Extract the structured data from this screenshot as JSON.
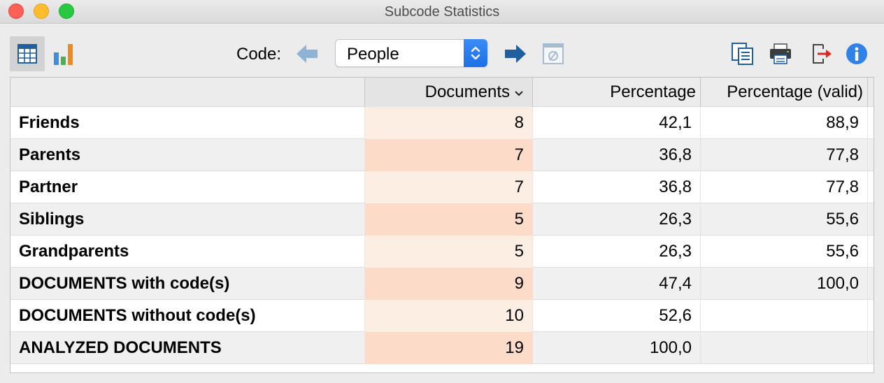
{
  "window": {
    "title": "Subcode Statistics"
  },
  "toolbar": {
    "code_label": "Code:",
    "code_select": {
      "value": "People"
    },
    "icons": {
      "table_view": "table-icon",
      "chart_view": "bar-chart-icon",
      "prev": "arrow-left-icon",
      "next": "arrow-right-icon",
      "clear": "clear-selection-icon",
      "copy": "copy-icon",
      "print": "printer-icon",
      "export": "export-icon",
      "info": "info-icon"
    }
  },
  "table": {
    "columns": [
      "",
      "Documents",
      "Percentage",
      "Percentage (valid)"
    ],
    "sorted_column": "Documents",
    "rows": [
      {
        "name": "Friends",
        "documents": "8",
        "percentage": "42,1",
        "percentage_valid": "88,9"
      },
      {
        "name": "Parents",
        "documents": "7",
        "percentage": "36,8",
        "percentage_valid": "77,8"
      },
      {
        "name": "Partner",
        "documents": "7",
        "percentage": "36,8",
        "percentage_valid": "77,8"
      },
      {
        "name": "Siblings",
        "documents": "5",
        "percentage": "26,3",
        "percentage_valid": "55,6"
      },
      {
        "name": "Grandparents",
        "documents": "5",
        "percentage": "26,3",
        "percentage_valid": "55,6"
      },
      {
        "name": "DOCUMENTS with code(s)",
        "documents": "9",
        "percentage": "47,4",
        "percentage_valid": "100,0"
      },
      {
        "name": "DOCUMENTS without code(s)",
        "documents": "10",
        "percentage": "52,6",
        "percentage_valid": ""
      },
      {
        "name": "ANALYZED DOCUMENTS",
        "documents": "19",
        "percentage": "100,0",
        "percentage_valid": ""
      }
    ]
  },
  "colors": {
    "documents_column_light": "#fdeee4",
    "documents_column_dark": "#fcdcc8",
    "accent_blue": "#1c6fe8",
    "arrow_blue": "#1f5f9e"
  }
}
